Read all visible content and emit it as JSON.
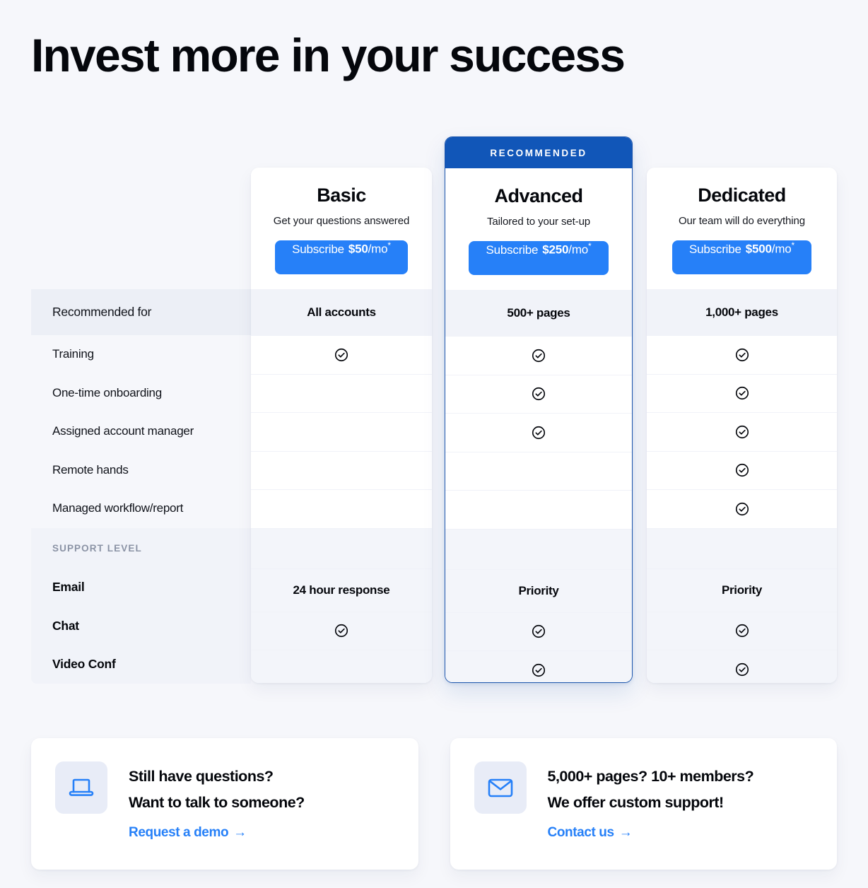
{
  "page": {
    "title": "Invest more in your success",
    "background_color": "#f6f7fb",
    "accent_blue": "#2680f8",
    "ribbon_blue": "#1156b8"
  },
  "ribbon_label": "RECOMMENDED",
  "plans": [
    {
      "name": "Basic",
      "tagline": "Get your questions answered",
      "cta_prefix": "Subscribe",
      "price": "$50",
      "per": "/mo",
      "star": "*",
      "recommended_for": "All accounts"
    },
    {
      "name": "Advanced",
      "tagline": "Tailored to your set-up",
      "cta_prefix": "Subscribe",
      "price": "$250",
      "per": "/mo",
      "star": "*",
      "recommended_for": "500+ pages"
    },
    {
      "name": "Dedicated",
      "tagline": "Our team will do everything",
      "cta_prefix": "Subscribe",
      "price": "$500",
      "per": "/mo",
      "star": "*",
      "recommended_for": "1,000+ pages"
    }
  ],
  "table": {
    "recommended_for_label": "Recommended for",
    "features": [
      {
        "label": "Training",
        "basic": "check",
        "advanced": "check",
        "dedicated": "check"
      },
      {
        "label": "One-time onboarding",
        "basic": "",
        "advanced": "check",
        "dedicated": "check"
      },
      {
        "label": "Assigned account manager",
        "basic": "",
        "advanced": "check",
        "dedicated": "check"
      },
      {
        "label": "Remote hands",
        "basic": "",
        "advanced": "",
        "dedicated": "check"
      },
      {
        "label": "Managed workflow/report",
        "basic": "",
        "advanced": "",
        "dedicated": "check"
      }
    ],
    "support_section_label": "SUPPORT LEVEL",
    "support": [
      {
        "label": "Email",
        "basic": "24 hour response",
        "advanced": "Priority",
        "dedicated": "Priority"
      },
      {
        "label": "Chat",
        "basic": "check",
        "advanced": "check",
        "dedicated": "check"
      },
      {
        "label": "Video Conf",
        "basic": "",
        "advanced": "check",
        "dedicated": "check"
      }
    ]
  },
  "cta_cards": [
    {
      "icon": "laptop-icon",
      "line1": "Still have questions?",
      "line2": "Want to talk to someone?",
      "link_label": "Request a demo",
      "link_arrow": "→"
    },
    {
      "icon": "envelope-icon",
      "line1": "5,000+ pages? 10+ members?",
      "line2": "We offer custom support!",
      "link_label": "Contact us",
      "link_arrow": "→"
    }
  ]
}
